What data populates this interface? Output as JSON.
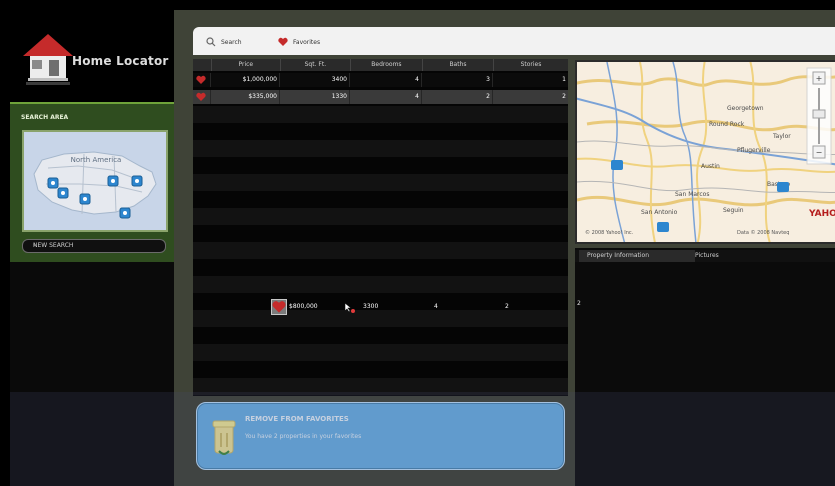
{
  "app": {
    "name": "Home Locator"
  },
  "sidebar": {
    "search_title": "SEARCH AREA",
    "map_label": "North America",
    "search_dropdown": "NEW SEARCH"
  },
  "toolbar": {
    "search_label": "Search",
    "favorites_label": "Favorites"
  },
  "results": {
    "columns": [
      "Price",
      "Sqt. Ft.",
      "Bedrooms",
      "Baths",
      "Stories"
    ],
    "rows": [
      {
        "price": "$1,000,000",
        "sqft": "3400",
        "bedrooms": "4",
        "baths": "3",
        "stories": "1"
      },
      {
        "price": "$335,000",
        "sqft": "1330",
        "bedrooms": "4",
        "baths": "2",
        "stories": "2"
      }
    ],
    "dragged": {
      "price": "$800,000",
      "sqft": "3300",
      "bedrooms": "4",
      "baths": "2",
      "stories": "2"
    }
  },
  "map": {
    "labels": [
      "Round Rock",
      "Georgetown",
      "Taylor",
      "Pflugerville",
      "Austin",
      "Bastrop",
      "San Marcos",
      "San Antonio",
      "Seguin"
    ],
    "bottom_left": "© 2008 Yahoo! Inc.",
    "bottom_right": "Data © 2008 Navteq",
    "brand": "YAHOO!"
  },
  "details": {
    "tabs": [
      "Property Information",
      "Pictures"
    ],
    "value": "2"
  },
  "remove_favorites": {
    "title": "REMOVE FROM FAVORITES",
    "subtitle": "You have 2 properties in your favorites"
  }
}
